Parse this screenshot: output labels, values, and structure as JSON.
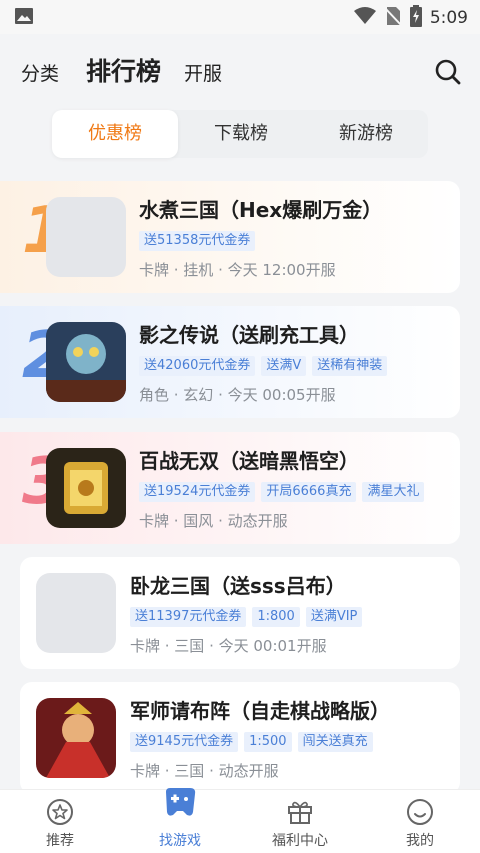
{
  "status_bar": {
    "time": "5:09"
  },
  "top_nav": {
    "category": "分类",
    "ranking": "排行榜",
    "open_server": "开服"
  },
  "tabs": [
    {
      "label": "优惠榜",
      "active": true
    },
    {
      "label": "下载榜",
      "active": false
    },
    {
      "label": "新游榜",
      "active": false
    }
  ],
  "games": [
    {
      "rank": "1",
      "title": "水煮三国（Hex爆刷万金）",
      "tags": [
        "送51358元代金券"
      ],
      "meta": "卡牌 · 挂机 · 今天 12:00开服",
      "bg": "#fdf1e4",
      "rank_color": "#f5a04a"
    },
    {
      "rank": "2",
      "title": "影之传说（送刷充工具）",
      "tags": [
        "送42060元代金券",
        "送满V",
        "送稀有神装"
      ],
      "meta": "角色 · 玄幻 · 今天 00:05开服",
      "bg": "#e7effc",
      "rank_color": "#5f8fe0"
    },
    {
      "rank": "3",
      "title": "百战无双（送暗黑悟空）",
      "tags": [
        "送19524元代金券",
        "开局6666真充",
        "满星大礼"
      ],
      "meta": "卡牌 · 国风 · 动态开服",
      "bg": "#fde8ea",
      "rank_color": "#f07a8a"
    },
    {
      "rank": "",
      "title": "卧龙三国（送sss吕布）",
      "tags": [
        "送11397元代金券",
        "1:800",
        "送满VIP"
      ],
      "meta": "卡牌 · 三国 · 今天 00:01开服",
      "bg": "#ffffff",
      "rank_color": ""
    },
    {
      "rank": "",
      "title": "军师请布阵（自走棋战略版）",
      "tags": [
        "送9145元代金券",
        "1:500",
        "闯关送真充"
      ],
      "meta": "卡牌 · 三国 · 动态开服",
      "bg": "#ffffff",
      "rank_color": ""
    }
  ],
  "bottom_nav": [
    {
      "label": "推荐",
      "icon": "star-circle-icon",
      "active": false
    },
    {
      "label": "找游戏",
      "icon": "gamepad-icon",
      "active": true
    },
    {
      "label": "福利中心",
      "icon": "gift-icon",
      "active": false
    },
    {
      "label": "我的",
      "icon": "smile-face-icon",
      "active": false
    }
  ]
}
